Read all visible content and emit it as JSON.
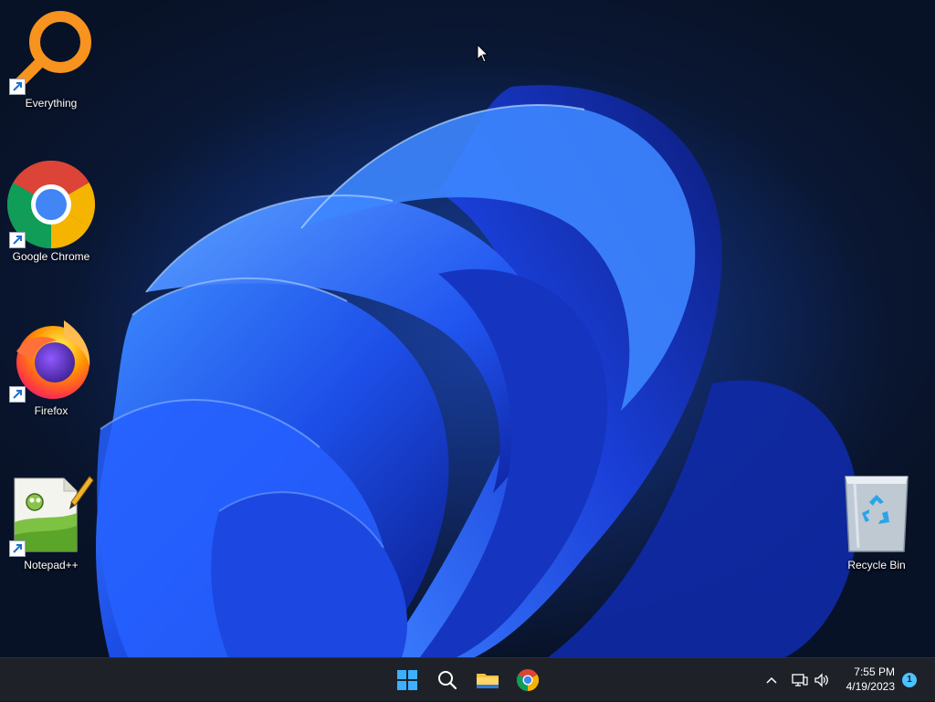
{
  "desktop": {
    "icons": [
      {
        "name": "Everything"
      },
      {
        "name": "Google Chrome"
      },
      {
        "name": "Firefox"
      },
      {
        "name": "Notepad++"
      },
      {
        "name": "Recycle Bin"
      }
    ]
  },
  "taskbar": {
    "pinned": [
      "start-icon",
      "search-icon",
      "file-explorer-icon",
      "chrome-icon"
    ],
    "tray": {
      "overflow_icon": "chevron-up-icon",
      "network_icon": "network-icon",
      "volume_icon": "volume-icon",
      "time": "7:55 PM",
      "date": "4/19/2023",
      "notification_count": "1"
    }
  },
  "colors": {
    "taskbar_bg": "#1e2228",
    "accent": "#4cc2ff",
    "wallpaper_blue": "#1f5bff"
  }
}
